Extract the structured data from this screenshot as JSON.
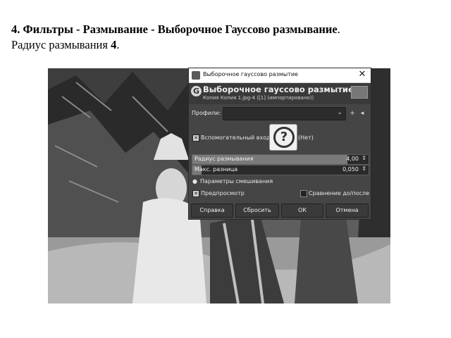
{
  "document": {
    "line1_bold": "4. Фильтры - Размывание - Выборочное Гауссово размывание",
    "line1_tail": ".",
    "line2_text": "Радиус размывания ",
    "line2_bold": "4",
    "line2_tail": "."
  },
  "dialog": {
    "window_title": "Выборочное гауссово размытие",
    "header_title": "Выборочное гауссово размытие",
    "header_subtitle": "Копия Копия 1.jpg-4 ([1] (импортировано))",
    "profiles_label": "Профили:",
    "profiles_value": "",
    "aux_input_label": "Вспомогательный вход",
    "aux_input_value": "(Нет)",
    "blur_radius": {
      "label": "Радиус размывания",
      "value": "4,00",
      "fill_fraction": 0.88
    },
    "max_delta": {
      "label": "Макс. разница",
      "value": "0,050",
      "fill_fraction": 0.05
    },
    "blend_options_label": "Параметры смешивания",
    "preview_label": "Предпросмотр",
    "split_view_label": "Сравнение до/после",
    "buttons": {
      "help": "Справка",
      "reset": "Сбросить",
      "ok": "ОК",
      "cancel": "Отмена"
    }
  }
}
